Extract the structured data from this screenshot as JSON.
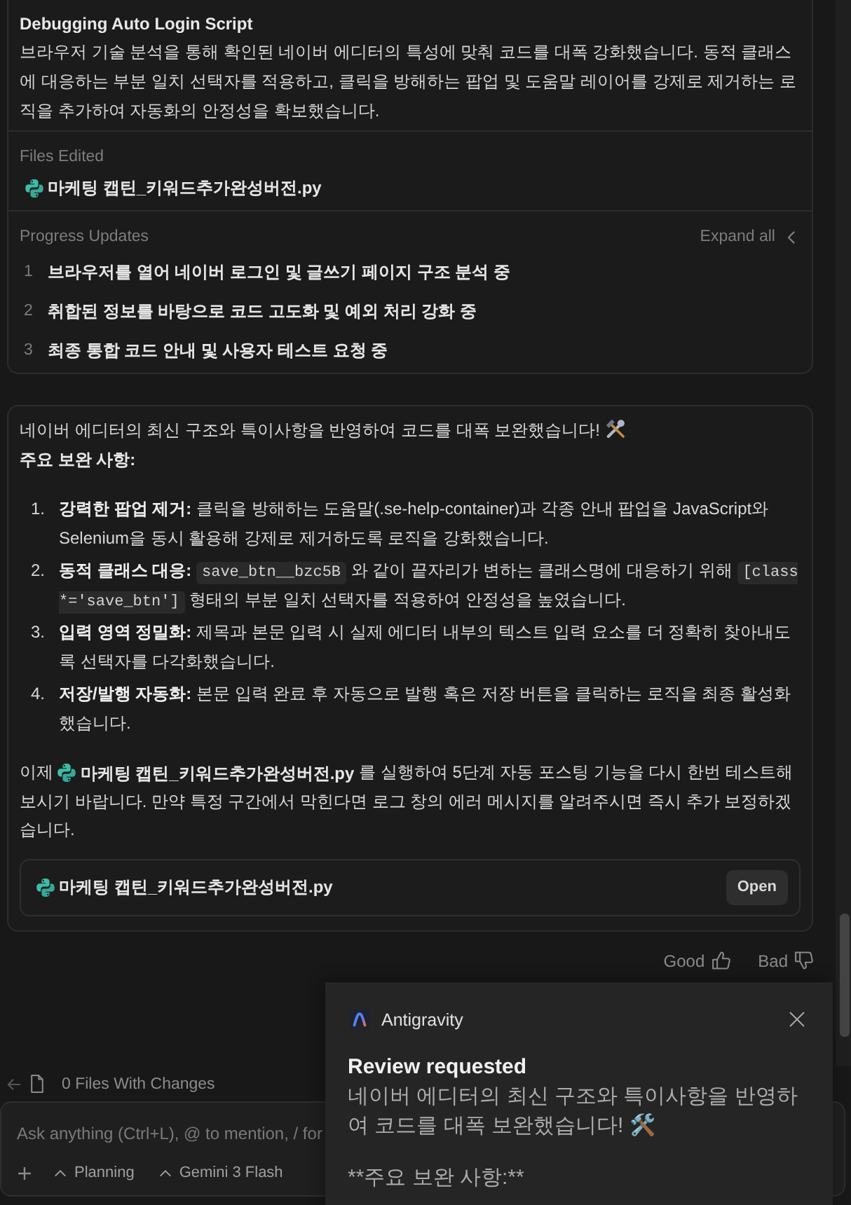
{
  "task_card": {
    "title": "Debugging Auto Login Script",
    "summary": "브라우저 기술 분석을 통해 확인된 네이버 에디터의 특성에 맞춰 코드를 대폭 강화했습니다. 동적 클래스에 대응하는 부분 일치 선택자를 적용하고, 클릭을 방해하는 팝업 및 도움말 레이어를 강제로 제거하는 로직을 추가하여 자동화의 안정성을 확보했습니다.",
    "files_edited": {
      "label": "Files Edited",
      "files": [
        {
          "name": "마케팅 캡틴_키워드추가완성버전.py"
        }
      ]
    },
    "progress": {
      "label": "Progress Updates",
      "toggle": "Expand all",
      "steps": [
        {
          "number": "1",
          "text": "브라우저를 열어 네이버 로그인 및 글쓰기 페이지 구조 분석 중"
        },
        {
          "number": "2",
          "text": "취합된 정보를 바탕으로 코드 고도화 및 예외 처리 강화 중"
        },
        {
          "number": "3",
          "text": "최종 통합 코드 안내 및 사용자 테스트 요청 중"
        }
      ]
    }
  },
  "message": {
    "intro": "네이버 에디터의 최신 구조와 특이사항을 반영하여 코드를 대폭 보완했습니다!",
    "heading": "주요 보완 사항:",
    "items": [
      {
        "number": "1.",
        "parts": [
          {
            "kind": "strong",
            "text": "강력한 팝업 제거:"
          },
          {
            "kind": "plain",
            "text": " 클릭을 방해하는 도움말(.se-help-container)과 각종 안내 팝업을 JavaScript와 Selenium을 동시 활용해 강제로 제거하도록 로직을 강화했습니다."
          }
        ]
      },
      {
        "number": "2.",
        "parts": [
          {
            "kind": "strong",
            "text": "동적 클래스 대응: "
          },
          {
            "kind": "code",
            "text": "save_btn__bzc5B"
          },
          {
            "kind": "plain",
            "text": " 와 같이 끝자리가 변하는 클래스명에 대응하기 위해 "
          },
          {
            "kind": "code",
            "text": "[class *='save_btn']"
          },
          {
            "kind": "plain",
            "text": " 형태의 부분 일치 선택자를 적용하여 안정성을 높였습니다."
          }
        ]
      },
      {
        "number": "3.",
        "parts": [
          {
            "kind": "strong",
            "text": "입력 영역 정밀화:"
          },
          {
            "kind": "plain",
            "text": " 제목과 본문 입력 시 실제 에디터 내부의 텍스트 입력 요소를 더 정확히 찾아내도록 선택자를 다각화했습니다."
          }
        ]
      },
      {
        "number": "4.",
        "parts": [
          {
            "kind": "strong",
            "text": "저장/발행 자동화:"
          },
          {
            "kind": "plain",
            "text": " 본문 입력 완료 후 자동으로 발행 혹은 저장 버튼을 클릭하는 로직을 최종 활성화했습니다."
          }
        ]
      }
    ],
    "closing": [
      {
        "kind": "plain",
        "text": "이제 "
      },
      {
        "kind": "file",
        "text": "마케팅 캡틴_키워드추가완성버전.py"
      },
      {
        "kind": "plain",
        "text": " 를 실행하여 5단계 자동 포스팅 기능을 다시 한번 테스트해 보시기 바랍니다. 만약 특정 구간에서 막힌다면 로그 창의 에러 메시지를 알려주시면 즉시 추가 보정하겠습니다."
      }
    ],
    "attachment": {
      "name": "마케팅 캡틴_키워드추가완성버전.py",
      "button": "Open"
    }
  },
  "feedback": [
    {
      "label": "Good",
      "kind": "up"
    },
    {
      "label": "Bad",
      "kind": "down"
    }
  ],
  "changes_bar": {
    "label": "0 Files With Changes"
  },
  "composer": {
    "placeholder": "Ask anything (Ctrl+L), @ to mention, / for",
    "selectors": [
      {
        "label": "Planning"
      },
      {
        "label": "Gemini 3 Flash"
      }
    ]
  },
  "notification": {
    "app": "Antigravity",
    "title": "Review requested",
    "paragraphs": [
      "네이버 에디터의 최신 구조와 특이사항을 반영하여 코드를 대폭 보완했습니다! 🛠️",
      "**주요 보완 사항:**"
    ]
  }
}
